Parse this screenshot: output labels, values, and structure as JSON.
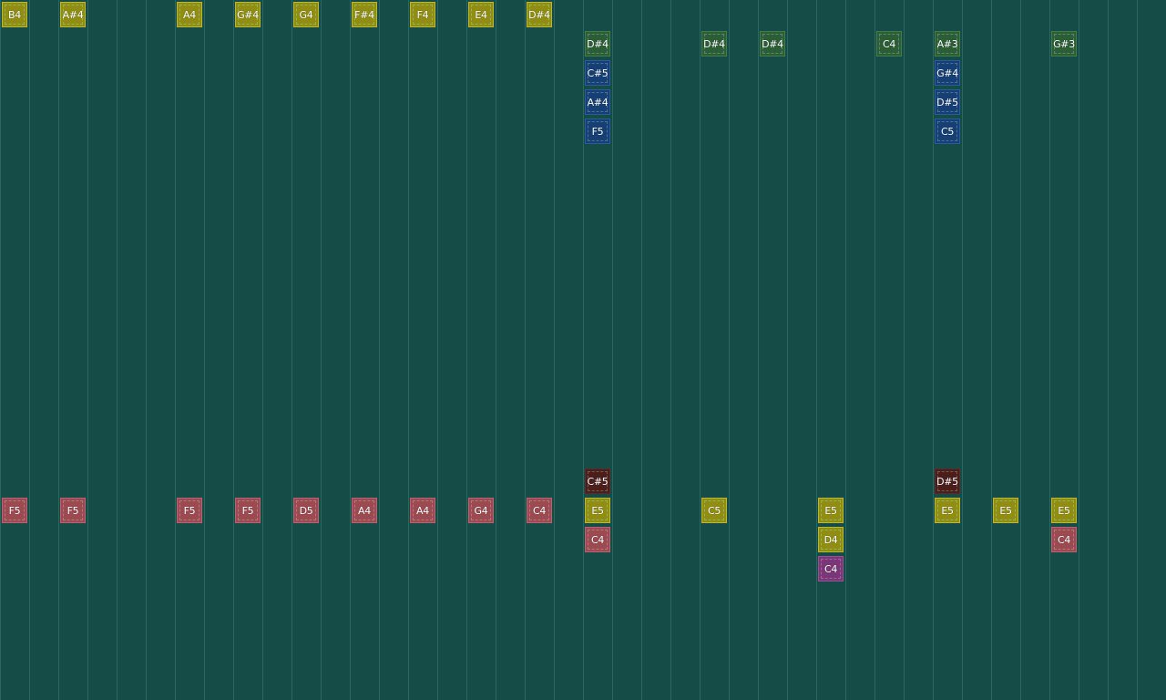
{
  "colors": {
    "background": "#154c47",
    "grid_line": "#4f8a82",
    "yellow": "#8e8e14",
    "green": "#2b5e36",
    "blue": "#163f74",
    "red": "#9a4a50",
    "maroon": "#4a1e1a",
    "purple": "#7a3777"
  },
  "notes": [
    {
      "label": "B4",
      "col": 0,
      "row": 0,
      "color": "yellow"
    },
    {
      "label": "A#4",
      "col": 2,
      "row": 0,
      "color": "yellow"
    },
    {
      "label": "A4",
      "col": 6,
      "row": 0,
      "color": "yellow"
    },
    {
      "label": "G#4",
      "col": 8,
      "row": 0,
      "color": "yellow"
    },
    {
      "label": "G4",
      "col": 10,
      "row": 0,
      "color": "yellow"
    },
    {
      "label": "F#4",
      "col": 12,
      "row": 0,
      "color": "yellow"
    },
    {
      "label": "F4",
      "col": 14,
      "row": 0,
      "color": "yellow"
    },
    {
      "label": "E4",
      "col": 16,
      "row": 0,
      "color": "yellow"
    },
    {
      "label": "D#4",
      "col": 18,
      "row": 0,
      "color": "yellow"
    },
    {
      "label": "D#4",
      "col": 20,
      "row": 1,
      "color": "green"
    },
    {
      "label": "D#4",
      "col": 24,
      "row": 1,
      "color": "green"
    },
    {
      "label": "D#4",
      "col": 26,
      "row": 1,
      "color": "green"
    },
    {
      "label": "C4",
      "col": 30,
      "row": 1,
      "color": "green"
    },
    {
      "label": "A#3",
      "col": 32,
      "row": 1,
      "color": "green"
    },
    {
      "label": "G#3",
      "col": 36,
      "row": 1,
      "color": "green"
    },
    {
      "label": "C#5",
      "col": 20,
      "row": 2,
      "color": "blue"
    },
    {
      "label": "A#4",
      "col": 20,
      "row": 3,
      "color": "blue"
    },
    {
      "label": "F5",
      "col": 20,
      "row": 4,
      "color": "blue"
    },
    {
      "label": "G#4",
      "col": 32,
      "row": 2,
      "color": "blue"
    },
    {
      "label": "D#5",
      "col": 32,
      "row": 3,
      "color": "blue"
    },
    {
      "label": "C5",
      "col": 32,
      "row": 4,
      "color": "blue"
    },
    {
      "label": "C#5",
      "col": 20,
      "row": 16,
      "color": "maroon"
    },
    {
      "label": "D#5",
      "col": 32,
      "row": 16,
      "color": "maroon"
    },
    {
      "label": "F5",
      "col": 0,
      "row": 17,
      "color": "red"
    },
    {
      "label": "F5",
      "col": 2,
      "row": 17,
      "color": "red"
    },
    {
      "label": "F5",
      "col": 6,
      "row": 17,
      "color": "red"
    },
    {
      "label": "F5",
      "col": 8,
      "row": 17,
      "color": "red"
    },
    {
      "label": "D5",
      "col": 10,
      "row": 17,
      "color": "red"
    },
    {
      "label": "A4",
      "col": 12,
      "row": 17,
      "color": "red"
    },
    {
      "label": "A4",
      "col": 14,
      "row": 17,
      "color": "red"
    },
    {
      "label": "G4",
      "col": 16,
      "row": 17,
      "color": "red"
    },
    {
      "label": "C4",
      "col": 18,
      "row": 17,
      "color": "red"
    },
    {
      "label": "E5",
      "col": 20,
      "row": 17,
      "color": "yellow"
    },
    {
      "label": "C5",
      "col": 24,
      "row": 17,
      "color": "yellow"
    },
    {
      "label": "E5",
      "col": 28,
      "row": 17,
      "color": "yellow"
    },
    {
      "label": "E5",
      "col": 32,
      "row": 17,
      "color": "yellow"
    },
    {
      "label": "E5",
      "col": 34,
      "row": 17,
      "color": "yellow"
    },
    {
      "label": "E5",
      "col": 36,
      "row": 17,
      "color": "yellow"
    },
    {
      "label": "C4",
      "col": 20,
      "row": 18,
      "color": "red"
    },
    {
      "label": "D4",
      "col": 28,
      "row": 18,
      "color": "yellow"
    },
    {
      "label": "C4",
      "col": 36,
      "row": 18,
      "color": "red"
    },
    {
      "label": "C4",
      "col": 28,
      "row": 19,
      "color": "purple"
    }
  ]
}
